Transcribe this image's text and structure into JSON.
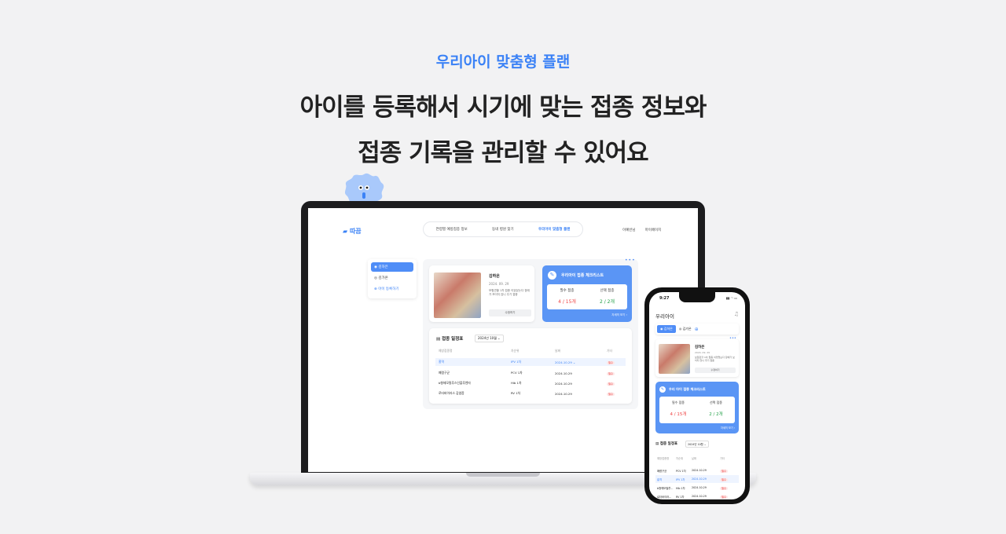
{
  "hero": {
    "eyebrow": "우리아이 맞춤형 플랜",
    "headline_line1": "아이를 등록해서 시기에 맞는 접종 정보와",
    "headline_line2": "접종 기록을 관리할 수 있어요"
  },
  "desktop": {
    "logo": "따끔",
    "nav": [
      "연령별 예방접종 정보",
      "동네 병원 찾기",
      "우리아이 맞춤형 플랜"
    ],
    "user": {
      "name": "이예빈님",
      "mypage": "마이페이지"
    },
    "sidebar": [
      "김하은",
      "김가온",
      "아이 등록하기"
    ],
    "child": {
      "name": "김하은",
      "date": "2024. 09. 29",
      "note": "보험관할 1차 접종 이었었는다 장애가 보이지 않니 주기 접종",
      "edit": "수정하기"
    },
    "checklist": {
      "title": "우리아이 접종 체크리스트",
      "required_label": "필수 접종",
      "required_value": "4 / 15개",
      "optional_label": "선택 접종",
      "optional_value": "2 / 2개",
      "more": "자세히 보기"
    },
    "schedule": {
      "title": "접종 일정표",
      "month": "2024년 10월",
      "columns": [
        "예방접종명",
        "차순위",
        "날짜",
        "기타"
      ],
      "rows": [
        [
          "홍역",
          "IPV 1차",
          "2024.10.29",
          "필수"
        ],
        [
          "폐렴구균",
          "PCV 1차",
          "2024.10.29",
          "필수"
        ],
        [
          "b형헤모필루스인플루엔자",
          "Hib 1차",
          "2024.10.29",
          "필수"
        ],
        [
          "로타바이러스 감염증",
          "RV 1차",
          "2024.10.29",
          "필수"
        ]
      ]
    }
  },
  "mobile": {
    "time": "9:27",
    "status": "▮▮ ◠ ▭",
    "title": "우리아이",
    "tabs": [
      "김하은",
      "김가온"
    ],
    "child": {
      "name": "김하은",
      "date": "2024. 09. 29",
      "note": "보험관할 1차 접종 이었었는다 장애가 보이지 않니 주기 접종",
      "edit": "수정하기"
    },
    "checklist": {
      "title": "우리 아이 접종 체크리스트",
      "required_label": "필수 접종",
      "required_value": "4 / 15개",
      "optional_label": "선택 접종",
      "optional_value": "2 / 2개",
      "more": "자세히 보기"
    },
    "schedule": {
      "title": "접종 일정표",
      "month": "2024년 10월",
      "columns": [
        "예방접종명",
        "차순위",
        "날짜",
        "기타"
      ],
      "rows": [
        [
          "폐렴구균",
          "PCV 1차",
          "2024.10.29",
          "필수"
        ],
        [
          "홍역",
          "IPV 1차",
          "2024.10.29",
          "필수"
        ],
        [
          "b형헤모필루...",
          "Hib 1차",
          "2024.10.29",
          "필수"
        ],
        [
          "로타바이러...",
          "RV 1차",
          "2024.10.29",
          "필수"
        ]
      ]
    }
  }
}
